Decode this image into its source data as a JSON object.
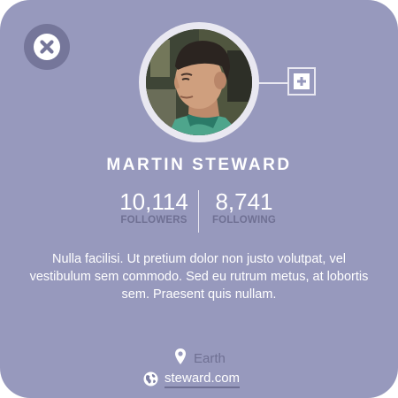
{
  "profile": {
    "name": "MARTIN STEWARD",
    "avatar_alt": "profile photo",
    "stats": {
      "followers_count": "10,114",
      "followers_label": "FOLLOWERS",
      "following_count": "8,741",
      "following_label": "FOLLOWING"
    },
    "bio": "Nulla facilisi. Ut pretium dolor non justo volutpat, vel vestibulum sem commodo. Sed eu rutrum metus, at lobortis sem. Praesent quis nullam.",
    "location": "Earth",
    "website": "steward.com"
  },
  "icons": {
    "close": "close-icon",
    "add": "plus-icon",
    "location": "map-pin-icon",
    "website": "globe-icon"
  },
  "colors": {
    "card_background": "#9799bd",
    "close_button": "#75769a",
    "muted_text": "#6f7093",
    "ring": "#e9e8f1",
    "text": "#ffffff"
  }
}
